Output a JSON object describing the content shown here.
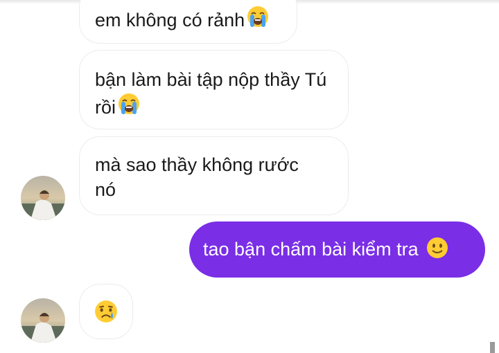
{
  "messages": [
    {
      "sender": "them",
      "text": "em không có rảnh",
      "emoji": "loudly-crying-face"
    },
    {
      "sender": "them",
      "text": "bận làm bài tập nộp thầy Tú rồi",
      "emoji": "loudly-crying-face"
    },
    {
      "sender": "them",
      "text": "mà sao thầy không rước nó",
      "emoji": ""
    },
    {
      "sender": "me",
      "text": "tao bận chấm bài kiểm tra",
      "emoji": "slightly-smiling-face"
    },
    {
      "sender": "them",
      "text": "",
      "emoji": "crying-face"
    }
  ],
  "colors": {
    "outgoing_bubble": "#7a2ee6",
    "incoming_bubble": "#ffffff",
    "incoming_border": "#ececec",
    "emoji_face": "#ffcc33",
    "tears": "#4aa3f0"
  },
  "icons": [
    "loudly-crying-face",
    "slightly-smiling-face",
    "crying-face",
    "contact-avatar"
  ]
}
